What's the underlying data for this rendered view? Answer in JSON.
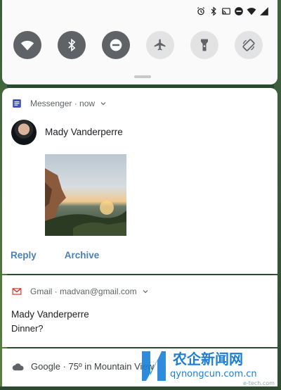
{
  "quick_settings": {
    "status_icons": [
      "alarm-icon",
      "bluetooth-icon",
      "cast-icon",
      "dnd-icon",
      "wifi-icon",
      "battery-icon"
    ],
    "tiles": [
      {
        "name": "wifi-icon",
        "state": "on"
      },
      {
        "name": "bluetooth-icon",
        "state": "on"
      },
      {
        "name": "dnd-icon",
        "state": "on"
      },
      {
        "name": "airplane-icon",
        "state": "off"
      },
      {
        "name": "flashlight-icon",
        "state": "off"
      },
      {
        "name": "rotate-icon",
        "state": "off"
      }
    ],
    "colors": {
      "on": "#5f6368",
      "off": "#e3e3e3"
    }
  },
  "messenger": {
    "app": "Messenger",
    "time": "now",
    "sender": "Mady Vanderperre",
    "actions": {
      "reply": "Reply",
      "archive": "Archive"
    },
    "accent_color": "#4a7fb8"
  },
  "gmail": {
    "app": "Gmail",
    "account": "madvan@gmail.com",
    "sender": "Mady Vanderperre",
    "message": "Dinner?"
  },
  "google": {
    "app": "Google",
    "weather_text": "75º in Mountain View"
  },
  "watermark": {
    "site_cn": "农企新闻网",
    "site_url": "qynongcun.com.cn",
    "sub": "e-tech.com"
  }
}
